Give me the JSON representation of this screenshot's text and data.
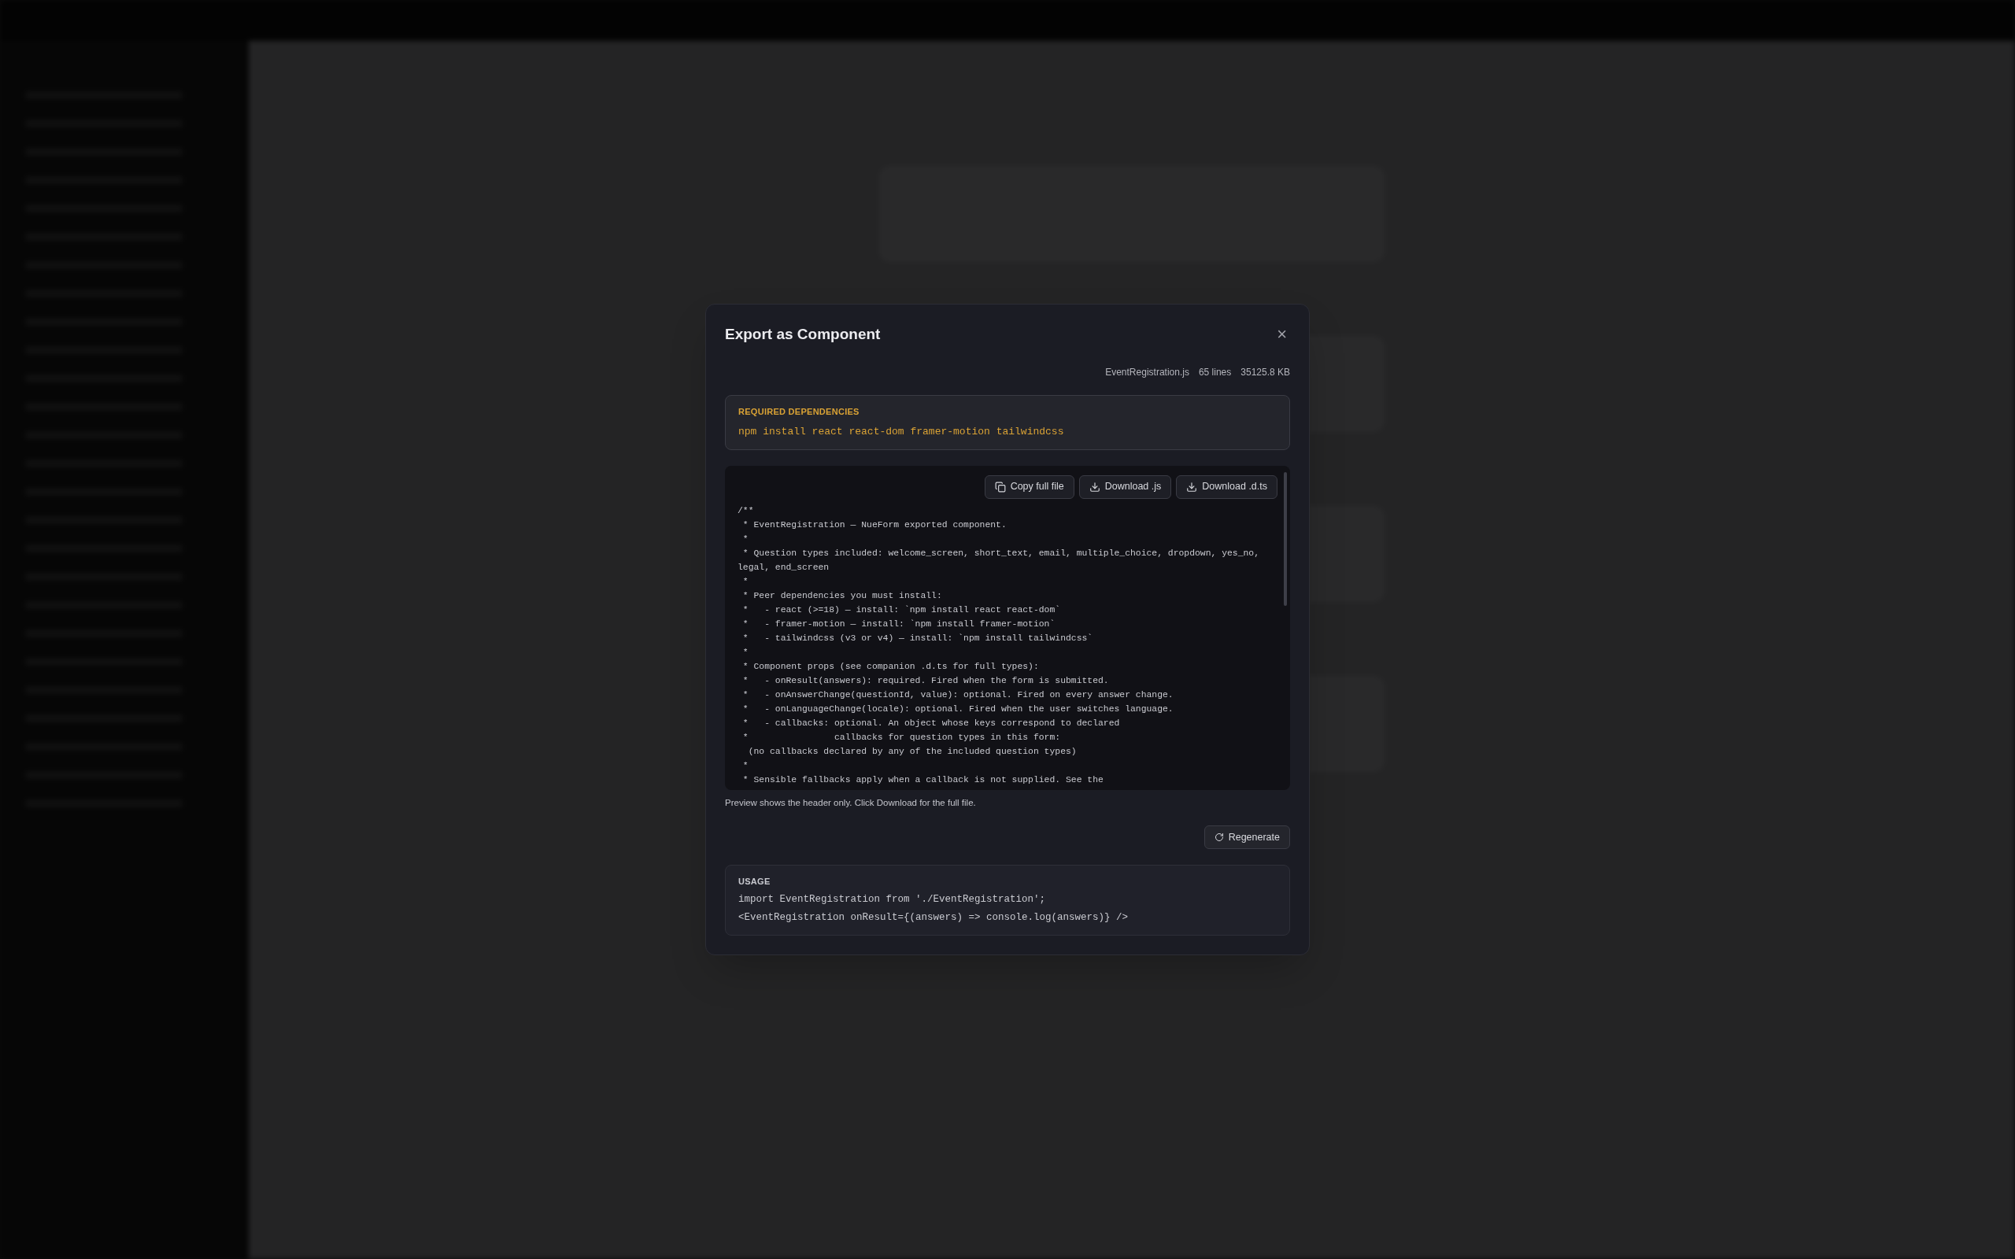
{
  "dialog": {
    "title": "Export as Component",
    "close": "×",
    "file_meta": [
      "EventRegistration.js",
      "65 lines",
      "35125.8 KB"
    ],
    "dependencies": {
      "label": "REQUIRED DEPENDENCIES",
      "command": "npm install react react-dom framer-motion tailwindcss"
    },
    "code_actions": [
      {
        "kind": "copy",
        "label": "Copy full file"
      },
      {
        "kind": "download",
        "label": "Download .js"
      },
      {
        "kind": "download",
        "label": "Download .d.ts"
      }
    ],
    "code_lines": [
      "/**",
      " * EventRegistration — NueForm exported component.",
      " *",
      " * Question types included: welcome_screen, short_text, email, multiple_choice, dropdown, yes_no,",
      "legal, end_screen",
      " *",
      " * Peer dependencies you must install:",
      " *   - react (>=18) — install: `npm install react react-dom`",
      " *   - framer-motion — install: `npm install framer-motion`",
      " *   - tailwindcss (v3 or v4) — install: `npm install tailwindcss`",
      " *",
      " * Component props (see companion .d.ts for full types):",
      " *   - onResult(answers): required. Fired when the form is submitted.",
      " *   - onAnswerChange(questionId, value): optional. Fired on every answer change.",
      " *   - onLanguageChange(locale): optional. Fired when the user switches language.",
      " *   - callbacks: optional. An object whose keys correspond to declared",
      " *                callbacks for question types in this form:",
      "  (no callbacks declared by any of the included question types)",
      " *",
      " * Sensible fallbacks apply when a callback is not supplied. See the"
    ],
    "preview_note": "Preview shows the header only. Click Download for the full file.",
    "regenerate": "Regenerate",
    "usage": {
      "label": "USAGE",
      "lines": [
        "import EventRegistration from './EventRegistration';",
        "<EventRegistration onResult={(answers) => console.log(answers)} />"
      ]
    }
  }
}
